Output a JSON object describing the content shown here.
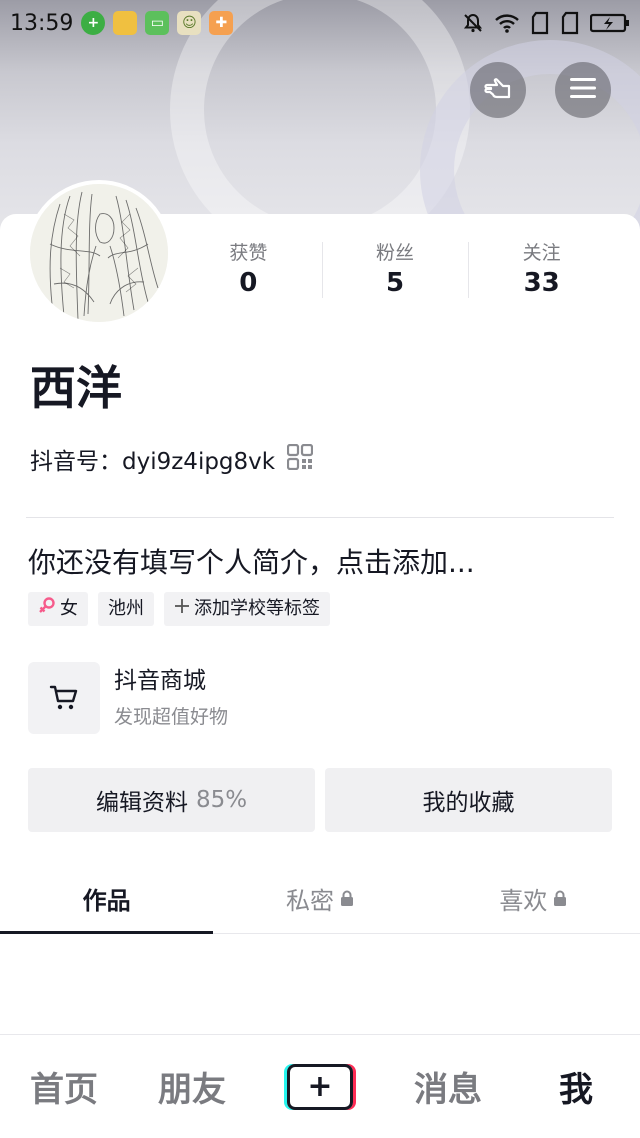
{
  "status": {
    "time": "13:59",
    "app_icons": [
      "plus-app-icon",
      "folder-icon",
      "android-app-icon",
      "face-app-icon",
      "plugin-icon"
    ],
    "right_icons": [
      "mute-icon",
      "wifi-icon",
      "sim1-icon",
      "sim2-icon",
      "battery-charging-icon"
    ]
  },
  "header": {
    "actions": [
      "hand-pointer-icon",
      "menu-icon"
    ]
  },
  "profile": {
    "name": "西洋",
    "douyin_id_label": "抖音号：",
    "douyin_id": "dyi9z4ipg8vk",
    "bio": "你还没有填写个人简介，点击添加...",
    "stats": [
      {
        "label": "获赞",
        "value": "0"
      },
      {
        "label": "粉丝",
        "value": "5"
      },
      {
        "label": "关注",
        "value": "33"
      }
    ],
    "tags": [
      {
        "label": "女",
        "icon": "female-icon"
      },
      {
        "label": "池州"
      },
      {
        "label": "添加学校等标签",
        "icon": "plus-icon"
      }
    ]
  },
  "mall": {
    "title": "抖音商城",
    "subtitle": "发现超值好物"
  },
  "buttons": {
    "edit_label": "编辑资料",
    "edit_progress": "85%",
    "favorites_label": "我的收藏"
  },
  "tabs": [
    {
      "label": "作品",
      "active": true
    },
    {
      "label": "私密",
      "locked": true
    },
    {
      "label": "喜欢",
      "locked": true
    }
  ],
  "bottom_nav": {
    "home": "首页",
    "friends": "朋友",
    "create": "+",
    "messages": "消息",
    "me": "我"
  },
  "colors": {
    "text_primary": "#161823",
    "text_secondary": "#8a8b90",
    "female_accent": "#f65b8b",
    "tiktok_cyan": "#25f4ee",
    "tiktok_red": "#fe2c55"
  }
}
